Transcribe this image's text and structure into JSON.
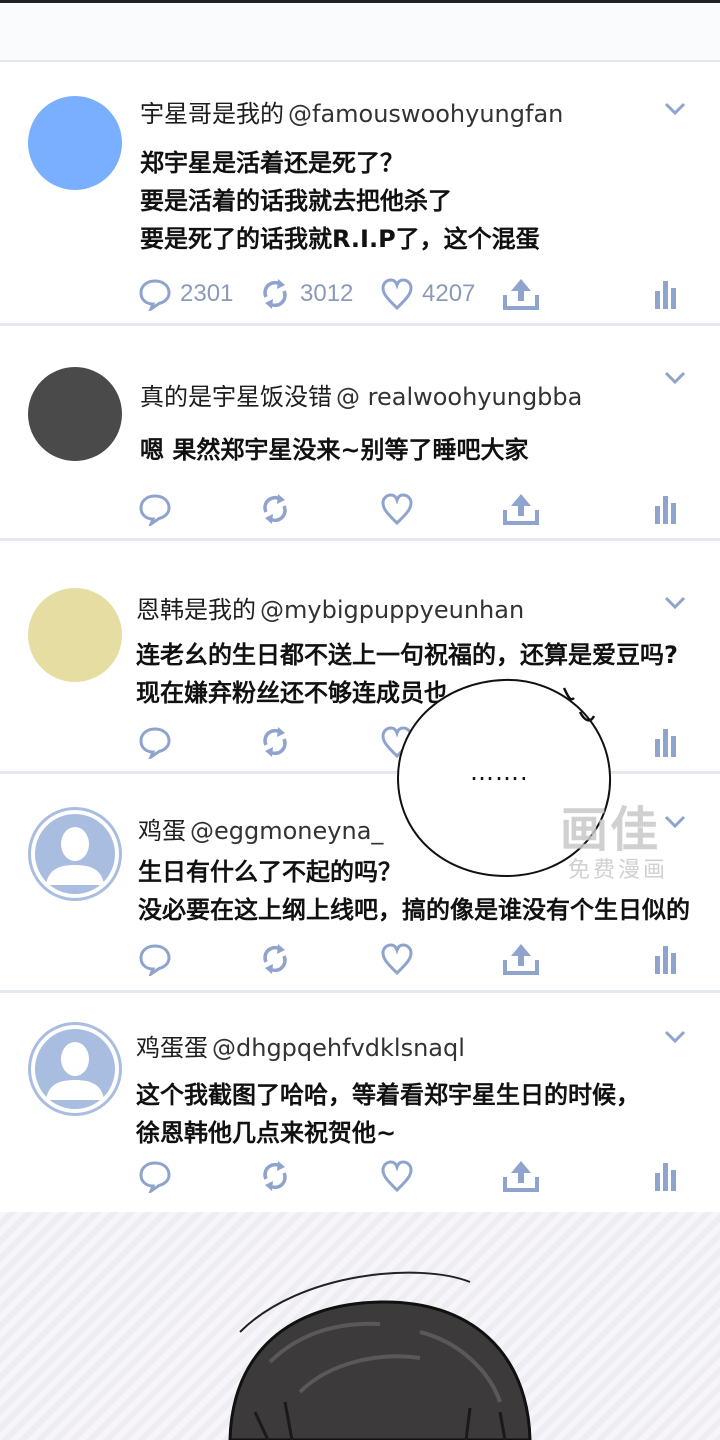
{
  "colors": {
    "icon": "#8fa4cc",
    "count": "#8b9ab8",
    "divider": "#e4e8f0",
    "avatar_blue": "#7aaeff",
    "avatar_gray": "#4a4a4a",
    "avatar_yellow": "#e6dda3",
    "avatar_default": "#a9bde0"
  },
  "posts": [
    {
      "username": "宇星哥是我的",
      "handle": "@famouswoohyungfan",
      "lines": [
        "郑宇星是活着还是死了？",
        "要是活着的话我就去把他杀了",
        "要是死了的话我就R.I.P了，这个混蛋"
      ],
      "counts": {
        "reply": "2301",
        "retweet": "3012",
        "like": "4207"
      }
    },
    {
      "username": "真的是宇星饭没错",
      "handle": "@ realwoohyungbba",
      "lines": [
        "嗯 果然郑宇星没来~别等了睡吧大家"
      ]
    },
    {
      "username": "恩韩是我的",
      "handle": "@mybigpuppyeunhan",
      "lines": [
        "连老幺的生日都不送上一句祝福的，还算是爱豆吗?",
        "现在嫌弃粉丝还不够连成员也"
      ]
    },
    {
      "username": "鸡蛋",
      "handle": "@eggmoneyna_",
      "lines": [
        "生日有什么了不起的吗？",
        "没必要在这上纲上线吧，搞的像是谁没有个生日似的"
      ]
    },
    {
      "username": "鸡蛋蛋",
      "handle": "@dhgpqehfvdklsnaql",
      "lines": [
        "这个我截图了哈哈，等着看郑宇星生日的时候，",
        "徐恩韩他几点来祝贺他~"
      ]
    }
  ],
  "bubble": {
    "text": "……."
  },
  "watermark": {
    "logo": "画佳",
    "sub": "免费漫画"
  }
}
